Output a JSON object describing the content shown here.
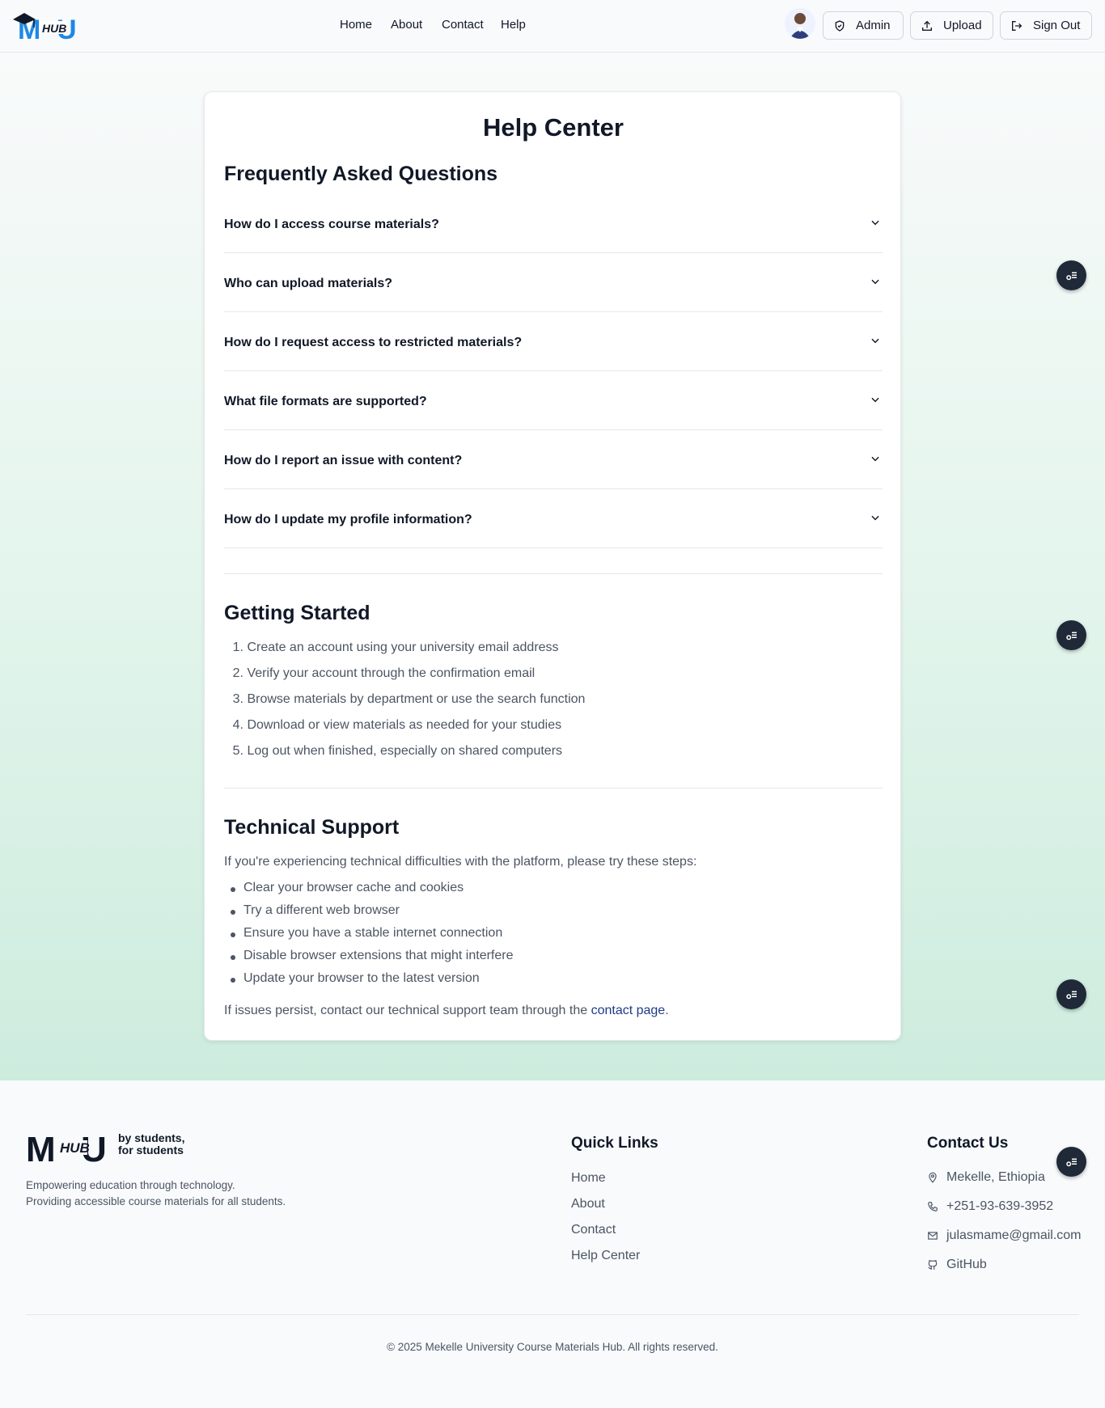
{
  "header": {
    "logo_text": "HUB",
    "nav": [
      "Home",
      "About",
      "Contact",
      "Help"
    ],
    "admin_label": "Admin",
    "upload_label": "Upload",
    "signout_label": "Sign Out"
  },
  "card": {
    "title": "Help Center",
    "faq_title": "Frequently Asked Questions",
    "faqs": [
      "How do I access course materials?",
      "Who can upload materials?",
      "How do I request access to restricted materials?",
      "What file formats are supported?",
      "How do I report an issue with content?",
      "How do I update my profile information?"
    ],
    "getting_started_title": "Getting Started",
    "getting_started_steps": [
      "Create an account using your university email address",
      "Verify your account through the confirmation email",
      "Browse materials by department or use the search function",
      "Download or view materials as needed for your studies",
      "Log out when finished, especially on shared computers"
    ],
    "tech_title": "Technical Support",
    "tech_intro": "If you're experiencing technical difficulties with the platform, please try these steps:",
    "tech_steps": [
      "Clear your browser cache and cookies",
      "Try a different web browser",
      "Ensure you have a stable internet connection",
      "Disable browser extensions that might interfere",
      "Update your browser to the latest version"
    ],
    "tech_outro_prefix": "If issues persist, contact our technical support team through the ",
    "tech_outro_link": "contact page",
    "tech_outro_suffix": "."
  },
  "footer": {
    "logo_text": "HUB",
    "tagline": "by students, for students",
    "desc_line1": "Empowering education through technology.",
    "desc_line2": "Providing accessible course materials for all students.",
    "quick_links_title": "Quick Links",
    "quick_links": [
      "Home",
      "About",
      "Contact",
      "Help Center"
    ],
    "contact_title": "Contact Us",
    "location": "Mekelle, Ethiopia",
    "phone": "+251-93-639-3952",
    "email": "julasmame@gmail.com",
    "github": "GitHub",
    "copyright": "© 2025 Mekelle University Course Materials Hub. All rights reserved."
  },
  "colors": {
    "primary_text": "#111827",
    "muted_text": "#4b5563",
    "link": "#1e3a8a",
    "logo_blue": "#1e88e5",
    "float_button": "#1f2937"
  },
  "icons": [
    "graduation-cap-icon",
    "shield-icon",
    "upload-icon",
    "sign-out-icon",
    "chevron-down-icon",
    "floating-menu-icon",
    "map-pin-icon",
    "phone-icon",
    "mail-icon",
    "github-icon"
  ]
}
